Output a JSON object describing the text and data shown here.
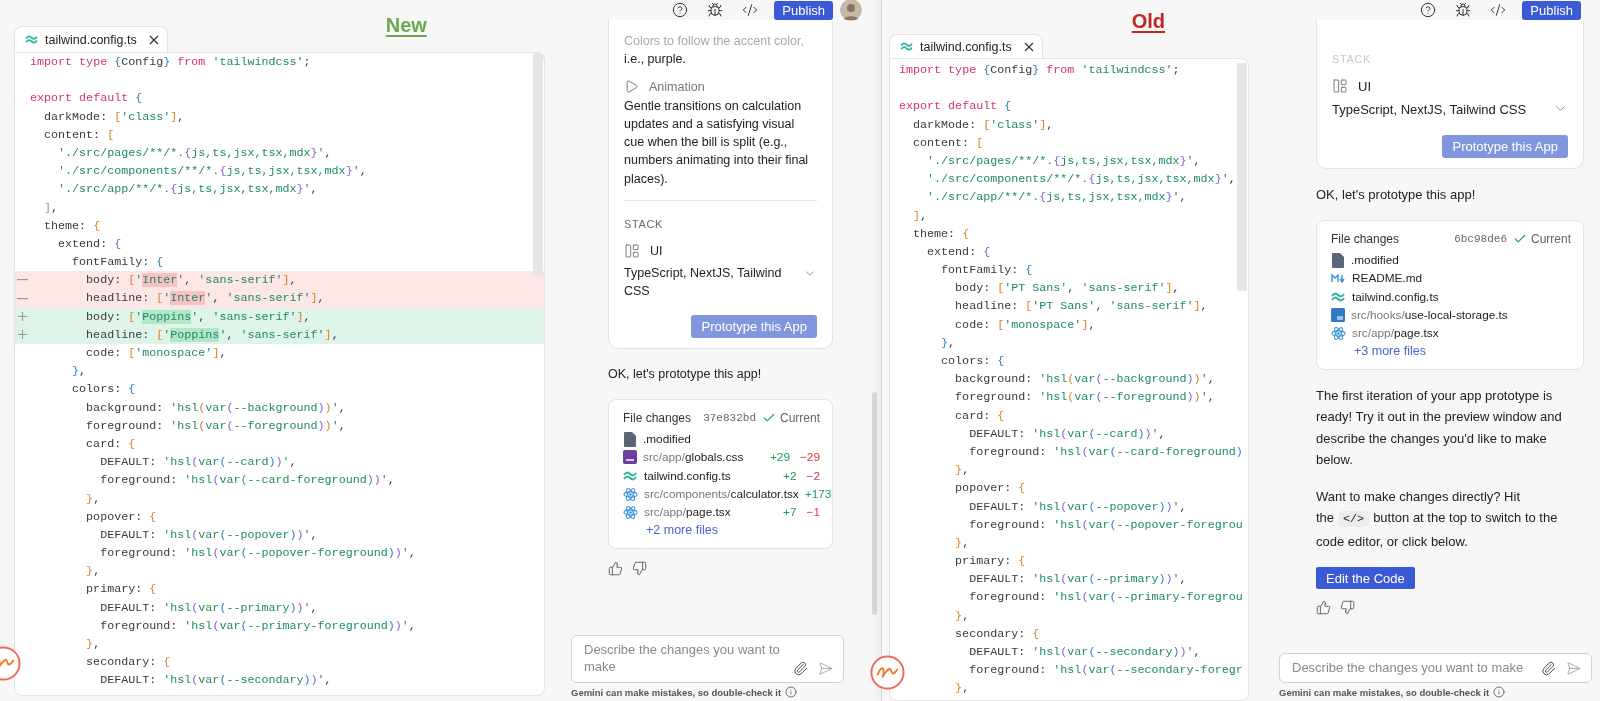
{
  "panels": [
    {
      "heading": {
        "text": "New",
        "color": "#6aa84f"
      },
      "editor": {
        "tab": "tailwind.config.ts",
        "lines": [
          {
            "kind": "code",
            "text": "import type {Config} from 'tailwindcss';"
          },
          {
            "kind": "blank"
          },
          {
            "kind": "code",
            "text": "export default {"
          },
          {
            "kind": "code",
            "text": "  darkMode: ['class'],"
          },
          {
            "kind": "code",
            "text": "  content: ["
          },
          {
            "kind": "code",
            "text": "    './src/pages/**/*.{js,ts,jsx,tsx,mdx}',"
          },
          {
            "kind": "code",
            "text": "    './src/components/**/*.{js,ts,jsx,tsx,mdx}',"
          },
          {
            "kind": "code",
            "text": "    './src/app/**/*.{js,ts,jsx,tsx,mdx}',"
          },
          {
            "kind": "code",
            "text": "  ],"
          },
          {
            "kind": "code",
            "text": "  theme: {"
          },
          {
            "kind": "code",
            "text": "    extend: {"
          },
          {
            "kind": "code",
            "text": "      fontFamily: {"
          },
          {
            "kind": "removed",
            "parts": [
              {
                "text": "        body: ['"
              },
              {
                "text": "Inter",
                "changed": true
              },
              {
                "text": "', 'sans-serif'],"
              }
            ]
          },
          {
            "kind": "removed",
            "parts": [
              {
                "text": "        headline: ['"
              },
              {
                "text": "Inter",
                "changed": true
              },
              {
                "text": "', 'sans-serif'],"
              }
            ]
          },
          {
            "kind": "added",
            "parts": [
              {
                "text": "        body: ['"
              },
              {
                "text": "Poppins",
                "changed": true
              },
              {
                "text": "', 'sans-serif'],"
              }
            ]
          },
          {
            "kind": "added",
            "parts": [
              {
                "text": "        headline: ['"
              },
              {
                "text": "Poppins",
                "changed": true
              },
              {
                "text": "', 'sans-serif'],"
              }
            ]
          },
          {
            "kind": "code",
            "text": "        code: ['monospace'],"
          },
          {
            "kind": "code",
            "text": "      },"
          },
          {
            "kind": "code",
            "text": "      colors: {"
          },
          {
            "kind": "code",
            "text": "        background: 'hsl(var(--background))',"
          },
          {
            "kind": "code",
            "text": "        foreground: 'hsl(var(--foreground))',"
          },
          {
            "kind": "code",
            "text": "        card: {"
          },
          {
            "kind": "code",
            "text": "          DEFAULT: 'hsl(var(--card))',"
          },
          {
            "kind": "code",
            "text": "          foreground: 'hsl(var(--card-foreground))',"
          },
          {
            "kind": "code",
            "text": "        },"
          },
          {
            "kind": "code",
            "text": "        popover: {"
          },
          {
            "kind": "code",
            "text": "          DEFAULT: 'hsl(var(--popover))',"
          },
          {
            "kind": "code",
            "text": "          foreground: 'hsl(var(--popover-foreground))',"
          },
          {
            "kind": "code",
            "text": "        },"
          },
          {
            "kind": "code",
            "text": "        primary: {"
          },
          {
            "kind": "code",
            "text": "          DEFAULT: 'hsl(var(--primary))',"
          },
          {
            "kind": "code",
            "text": "          foreground: 'hsl(var(--primary-foreground))',"
          },
          {
            "kind": "code",
            "text": "        },"
          },
          {
            "kind": "code",
            "text": "        secondary: {"
          },
          {
            "kind": "code",
            "text": "          DEFAULT: 'hsl(var(--secondary))',"
          }
        ]
      },
      "toolbar": {
        "publish": "Publish",
        "avatar": true
      },
      "chat": {
        "spec": {
          "items": [
            {
              "kind": "text",
              "text": "Colors to follow the accent color,",
              "faded": true
            },
            {
              "kind": "text",
              "text": "i.e., purple.",
              "faded": false
            },
            {
              "kind": "caption",
              "text": "Animation",
              "muted": true
            },
            {
              "kind": "text",
              "text": "Gentle transitions on calculation updates and a satisfying visual cue when the bill is split (e.g., numbers animating into their final places).",
              "faded": false
            },
            {
              "kind": "divider"
            },
            {
              "kind": "label",
              "text": "STACK",
              "faded": false
            },
            {
              "kind": "heading",
              "text": "UI",
              "muted": false
            },
            {
              "kind": "select",
              "text": "TypeScript, NextJS, Tailwind CSS"
            }
          ],
          "button": {
            "label": "Prototype this App",
            "disabled": true
          }
        },
        "messages": [
          {
            "kind": "text",
            "text": "OK, let's prototype this app!"
          },
          {
            "kind": "file_changes",
            "title": "File changes",
            "hash": "37e832bd",
            "status": "Current",
            "files": [
              {
                "kind": "file",
                "name": ".modified"
              },
              {
                "kind": "css",
                "dir": "src/app/",
                "name": "globals.css",
                "added": "+29",
                "removed": "−29"
              },
              {
                "kind": "tailwind",
                "name": "tailwind.config.ts",
                "added": "+2",
                "removed": "−2"
              },
              {
                "kind": "react",
                "dir": "src/components/",
                "name": "calculator.tsx",
                "added": "+173"
              },
              {
                "kind": "react",
                "dir": "src/app/",
                "name": "page.tsx",
                "added": "+7",
                "removed": "−1"
              }
            ],
            "more": "+2 more files"
          },
          {
            "kind": "feedback"
          }
        ],
        "composer": {
          "placeholder": "Describe the changes you want to make",
          "disclaimer": "Gemini can make mistakes, so double-check it"
        }
      }
    },
    {
      "heading": {
        "text": "Old",
        "color": "#c0281e"
      },
      "editor": {
        "tab": "tailwind.config.ts",
        "lines": [
          {
            "kind": "code",
            "text": "import type {Config} from 'tailwindcss';"
          },
          {
            "kind": "blank"
          },
          {
            "kind": "code",
            "text": "export default {"
          },
          {
            "kind": "code",
            "text": "  darkMode: ['class'],"
          },
          {
            "kind": "code",
            "text": "  content: ["
          },
          {
            "kind": "code",
            "text": "    './src/pages/**/*.{js,ts,jsx,tsx,mdx}',"
          },
          {
            "kind": "code",
            "text": "    './src/components/**/*.{js,ts,jsx,tsx,mdx}',"
          },
          {
            "kind": "code",
            "text": "    './src/app/**/*.{js,ts,jsx,tsx,mdx}',"
          },
          {
            "kind": "code",
            "text": "  ],"
          },
          {
            "kind": "code",
            "text": "  theme: {"
          },
          {
            "kind": "code",
            "text": "    extend: {"
          },
          {
            "kind": "code",
            "text": "      fontFamily: {"
          },
          {
            "kind": "code",
            "text": "        body: ['PT Sans', 'sans-serif'],"
          },
          {
            "kind": "code",
            "text": "        headline: ['PT Sans', 'sans-serif'],"
          },
          {
            "kind": "code",
            "text": "        code: ['monospace'],"
          },
          {
            "kind": "code",
            "text": "      },"
          },
          {
            "kind": "code",
            "text": "      colors: {"
          },
          {
            "kind": "code",
            "text": "        background: 'hsl(var(--background))',"
          },
          {
            "kind": "code",
            "text": "        foreground: 'hsl(var(--foreground))',"
          },
          {
            "kind": "code",
            "text": "        card: {"
          },
          {
            "kind": "code",
            "text": "          DEFAULT: 'hsl(var(--card))',"
          },
          {
            "kind": "code",
            "text": "          foreground: 'hsl(var(--card-foreground)"
          },
          {
            "kind": "code",
            "text": "        },"
          },
          {
            "kind": "code",
            "text": "        popover: {"
          },
          {
            "kind": "code",
            "text": "          DEFAULT: 'hsl(var(--popover))',"
          },
          {
            "kind": "code",
            "text": "          foreground: 'hsl(var(--popover-foregrou"
          },
          {
            "kind": "code",
            "text": "        },"
          },
          {
            "kind": "code",
            "text": "        primary: {"
          },
          {
            "kind": "code",
            "text": "          DEFAULT: 'hsl(var(--primary))',"
          },
          {
            "kind": "code",
            "text": "          foreground: 'hsl(var(--primary-foregrou"
          },
          {
            "kind": "code",
            "text": "        },"
          },
          {
            "kind": "code",
            "text": "        secondary: {"
          },
          {
            "kind": "code",
            "text": "          DEFAULT: 'hsl(var(--secondary))',"
          },
          {
            "kind": "code",
            "text": "          foreground: 'hsl(var(--secondary-foregr"
          },
          {
            "kind": "code",
            "text": "        },"
          }
        ]
      },
      "toolbar": {
        "publish": "Publish"
      },
      "chat": {
        "spec": {
          "items": [
            {
              "kind": "label",
              "text": "STACK",
              "faded": true
            },
            {
              "kind": "heading",
              "text": "UI",
              "muted": false
            },
            {
              "kind": "select",
              "text": "TypeScript, NextJS, Tailwind CSS"
            }
          ],
          "button": {
            "label": "Prototype this App",
            "disabled": true
          }
        },
        "messages": [
          {
            "kind": "text",
            "text": "OK, let's prototype this app!"
          },
          {
            "kind": "file_changes",
            "title": "File changes",
            "hash": "6bc98de6",
            "status": "Current",
            "files": [
              {
                "kind": "file",
                "name": ".modified"
              },
              {
                "kind": "markdown",
                "name": "README.md"
              },
              {
                "kind": "tailwind",
                "name": "tailwind.config.ts"
              },
              {
                "kind": "typescript",
                "dir": "src/hooks/",
                "name": "use-local-storage.ts"
              },
              {
                "kind": "react",
                "dir": "src/app/",
                "name": "page.tsx"
              }
            ],
            "more": "+3 more files"
          },
          {
            "kind": "text",
            "text": "The first iteration of your app prototype is ready! Try it out in the preview window and describe the changes you'd like to make below."
          },
          {
            "kind": "text_code",
            "before": "Want to make changes directly? Hit the",
            "code": "</>",
            "after": "button at the top to switch to the code editor, or click below."
          },
          {
            "kind": "button",
            "label": "Edit the Code"
          },
          {
            "kind": "feedback"
          }
        ],
        "composer": {
          "placeholder": "Describe the changes you want to make",
          "disclaimer": "Gemini can make mistakes, so double-check it"
        }
      }
    }
  ]
}
